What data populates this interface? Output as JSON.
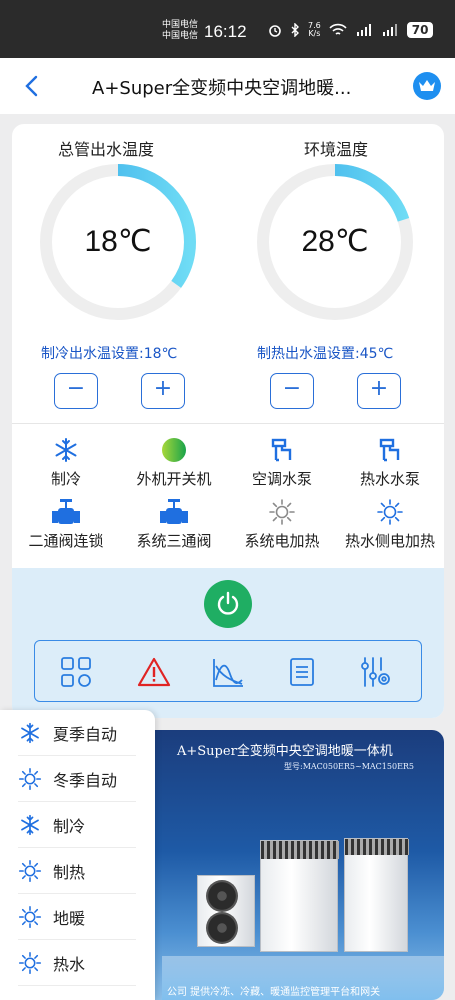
{
  "status_bar": {
    "carrier_1": "中国电信",
    "carrier_2": "中国电信",
    "time": "16:12",
    "net_speed_value": "7.6",
    "net_speed_unit": "K/s",
    "battery": "70"
  },
  "header": {
    "title": "A+Super全变频中央空调地暖...",
    "back_icon": "chevron-left-icon",
    "vip_icon": "crown-icon"
  },
  "gauges": [
    {
      "title": "总管出水温度",
      "value": "18℃",
      "setting": "制冷出水温设置:18℃",
      "level": 0.35
    },
    {
      "title": "环境温度",
      "value": "28℃",
      "setting": "制热出水温设置:45℃",
      "level": 0.2
    }
  ],
  "stepper": {
    "minus": "−",
    "plus": "+"
  },
  "functions": [
    {
      "label": "制冷",
      "icon": "snowflake-icon",
      "color": "#1f6fe0"
    },
    {
      "label": "外机开关机",
      "icon": "green-ball-icon",
      "color": "#2bb24c"
    },
    {
      "label": "空调水泵",
      "icon": "pump-icon",
      "color": "#1f6fe0"
    },
    {
      "label": "热水水泵",
      "icon": "pump-icon",
      "color": "#1f6fe0"
    },
    {
      "label": "二通阀连锁",
      "icon": "valve-icon",
      "color": "#1f6fe0"
    },
    {
      "label": "系统三通阀",
      "icon": "valve-icon",
      "color": "#1f6fe0"
    },
    {
      "label": "系统电加热",
      "icon": "sun-icon",
      "color": "#888888"
    },
    {
      "label": "热水侧电加热",
      "icon": "sun-icon",
      "color": "#1f6fe0"
    }
  ],
  "toolbar": [
    {
      "name": "grid-icon"
    },
    {
      "name": "warning-icon"
    },
    {
      "name": "chart-icon"
    },
    {
      "name": "list-icon"
    },
    {
      "name": "settings-sliders-icon"
    }
  ],
  "banner": {
    "title": "A+Super全变频中央空调地暖一体机",
    "model": "型号:MAC050ER5~MAC150ER5",
    "footer": "公司     提供冷冻、冷藏、暖通监控管理平台和网关"
  },
  "mode_menu": [
    {
      "label": "夏季自动",
      "icon": "snowflake-icon"
    },
    {
      "label": "冬季自动",
      "icon": "sun-icon"
    },
    {
      "label": "制冷",
      "icon": "snowflake-icon"
    },
    {
      "label": "制热",
      "icon": "sun-icon"
    },
    {
      "label": "地暖",
      "icon": "sun-icon"
    },
    {
      "label": "热水",
      "icon": "sun-icon"
    }
  ],
  "colors": {
    "accent": "#1f6fe0",
    "gauge_arc": "#4cc3f0",
    "power": "#1fae63",
    "control_bg": "#dcedf9"
  }
}
